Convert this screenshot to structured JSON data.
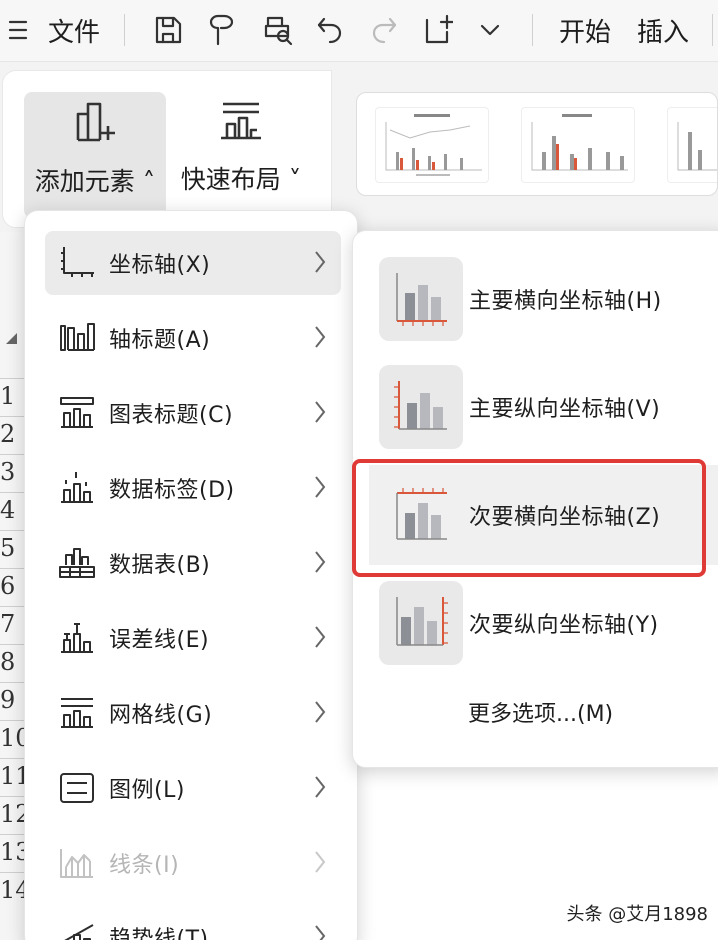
{
  "toolbar": {
    "file_label": "文件",
    "start_tab": "开始",
    "insert_tab": "插入"
  },
  "ribbon": {
    "add_element_label": "添加元素",
    "quick_layout_label": "快速布局"
  },
  "row_numbers": [
    "1",
    "2",
    "3",
    "4",
    "5",
    "6",
    "7",
    "8",
    "9",
    "10",
    "11",
    "12",
    "13",
    "14"
  ],
  "menu": {
    "items": [
      {
        "label": "坐标轴(X)",
        "icon": "axis-icon"
      },
      {
        "label": "轴标题(A)",
        "icon": "axis-title-icon"
      },
      {
        "label": "图表标题(C)",
        "icon": "chart-title-icon"
      },
      {
        "label": "数据标签(D)",
        "icon": "data-labels-icon"
      },
      {
        "label": "数据表(B)",
        "icon": "data-table-icon"
      },
      {
        "label": "误差线(E)",
        "icon": "error-bars-icon"
      },
      {
        "label": "网格线(G)",
        "icon": "gridlines-icon"
      },
      {
        "label": "图例(L)",
        "icon": "legend-icon"
      },
      {
        "label": "线条(I)",
        "icon": "lines-icon"
      },
      {
        "label": "趋势线(T)",
        "icon": "trendline-icon"
      }
    ]
  },
  "submenu": {
    "items": [
      {
        "label": "主要横向坐标轴(H)"
      },
      {
        "label": "主要纵向坐标轴(V)"
      },
      {
        "label": "次要横向坐标轴(Z)"
      },
      {
        "label": "次要纵向坐标轴(Y)"
      }
    ],
    "more_label": "更多选项...(M)"
  },
  "colors": {
    "highlight_border": "#e03a36",
    "axis_accent": "#d9583b",
    "bar_gray": "#8c8f96"
  },
  "watermark": "头条 @艾月1898"
}
